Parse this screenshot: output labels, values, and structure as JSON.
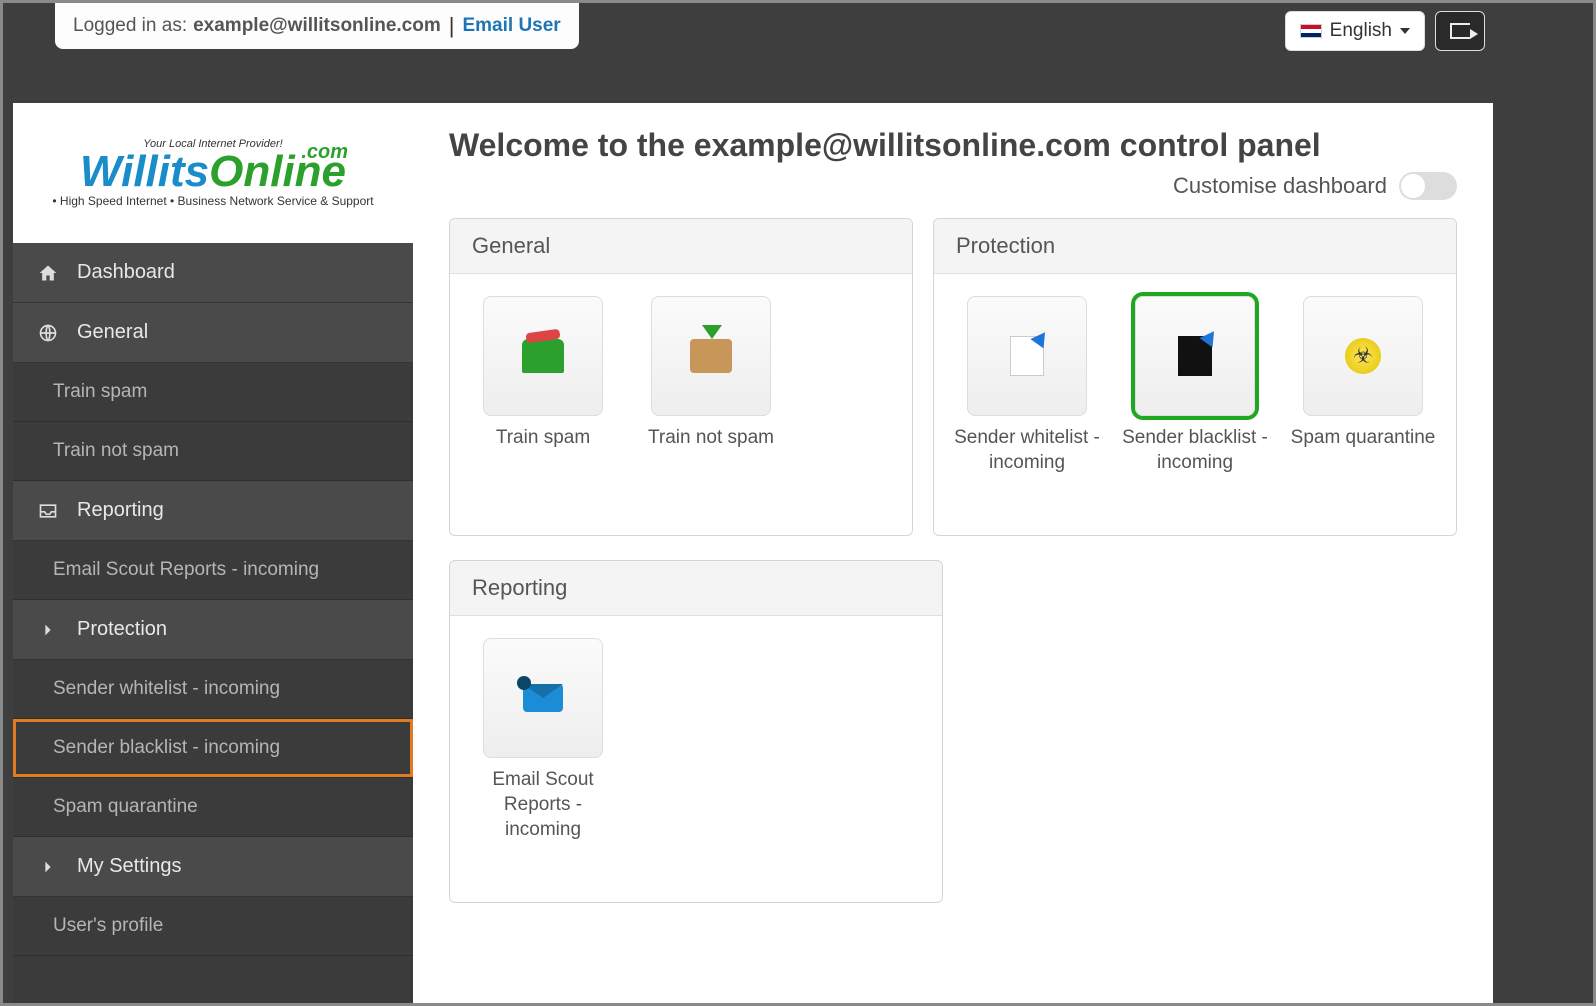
{
  "topbar": {
    "login_prefix": "Logged in as:",
    "login_email": "example@willitsonline.com",
    "email_user_link": "Email User",
    "language": "English"
  },
  "logo": {
    "tagline": "Your Local Internet Provider!",
    "name_part1": "Willits",
    "name_part2": "Online",
    "dotcom": ".com",
    "sub": "• High Speed Internet   • Business Network Service & Support"
  },
  "sidebar": {
    "items": [
      {
        "label": "Dashboard",
        "icon": "home"
      },
      {
        "label": "General",
        "icon": "globe"
      },
      {
        "label": "Reporting",
        "icon": "inbox"
      },
      {
        "label": "Protection",
        "icon": "chevron"
      },
      {
        "label": "My Settings",
        "icon": "chevron"
      }
    ],
    "subs": {
      "general": [
        {
          "label": "Train spam"
        },
        {
          "label": "Train not spam"
        }
      ],
      "reporting": [
        {
          "label": "Email Scout Reports - incoming"
        }
      ],
      "protection": [
        {
          "label": "Sender whitelist - incoming"
        },
        {
          "label": "Sender blacklist - incoming",
          "highlighted": true
        },
        {
          "label": "Spam quarantine"
        }
      ],
      "mysettings": [
        {
          "label": "User's profile"
        }
      ]
    }
  },
  "main": {
    "welcome": "Welcome to the example@willitsonline.com control panel",
    "customise": "Customise dashboard"
  },
  "panels": {
    "general": {
      "title": "General",
      "tiles": [
        {
          "label": "Train spam",
          "icon": "trash"
        },
        {
          "label": "Train not spam",
          "icon": "box"
        }
      ]
    },
    "protection": {
      "title": "Protection",
      "tiles": [
        {
          "label": "Sender whitelist - incoming",
          "icon": "doc-white"
        },
        {
          "label": "Sender blacklist - incoming",
          "icon": "doc-black",
          "highlighted": true
        },
        {
          "label": "Spam quarantine",
          "icon": "bio"
        }
      ]
    },
    "reporting": {
      "title": "Reporting",
      "tiles": [
        {
          "label": "Email Scout Reports - incoming",
          "icon": "mail"
        }
      ]
    }
  }
}
